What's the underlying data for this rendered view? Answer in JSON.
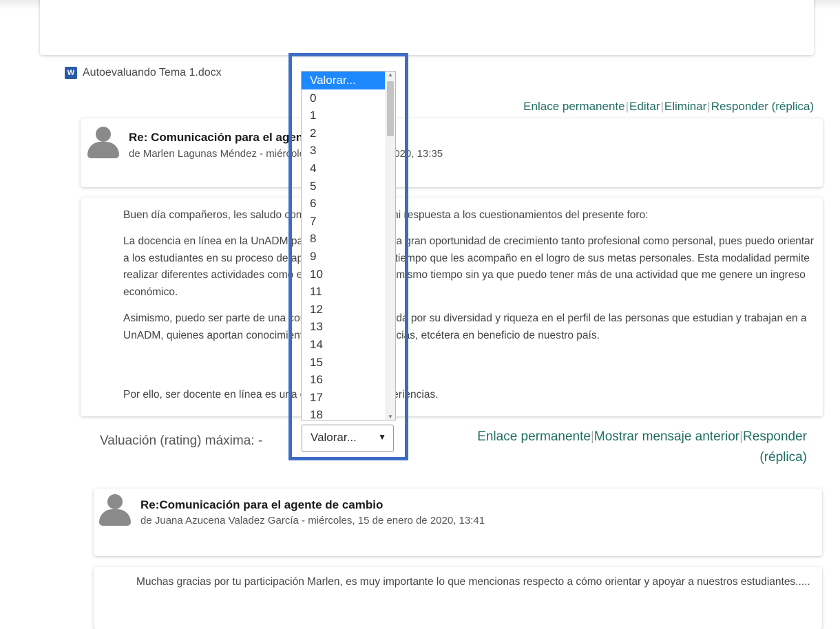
{
  "attachment": {
    "name": "Autoevaluando Tema 1.docx",
    "icon": "word-doc-icon"
  },
  "post1_links": [
    "Enlace permanente",
    "Editar",
    "Eliminar",
    "Responder (réplica)"
  ],
  "post2": {
    "title": "Re: Comunicación para el agente de cambio",
    "author": "de Marlen Lagunas Méndez - miércoles, 15 de enero de 2020, 13:35",
    "paragraphs": [
      "Buen día compañeros, les saludo con gusto y comparto mi respuesta a los cuestionamientos del presente foro:",
      "La docencia en línea en la UnADM para mí representa una gran oportunidad de crecimiento tanto profesional como personal, pues puedo orientar a los estudiantes en su proceso de aprendizaje al mismo tiempo que les acompaño en el logro de sus metas personales. Esta modalidad permite realizar diferentes actividades como estudiar y trabajar al mismo tiempo sin ya que puedo tener más de una actividad que me genere un ingreso económico.",
      "Asimismo, puedo ser parte de una comunidad caracterizada por su diversidad y riqueza en el perfil de las personas que estudian y trabajan en a UnADM, quienes aportan conocimientos, logros, experiencias, etcétera en beneficio de nuestro país.",
      "Por ello, ser docente en línea es una de mis mejores experiencias."
    ],
    "rating_label": "Valuación (rating) máxima: -",
    "links": [
      "Enlace permanente",
      "Mostrar mensaje anterior",
      "Responder",
      "(réplica)"
    ]
  },
  "rating_select": {
    "selected": "Valorar...",
    "options": [
      "Valorar...",
      "0",
      "1",
      "2",
      "3",
      "4",
      "5",
      "6",
      "7",
      "8",
      "9",
      "10",
      "11",
      "12",
      "13",
      "14",
      "15",
      "16",
      "17",
      "18"
    ]
  },
  "post3": {
    "title": "Re:Comunicación para el agente de cambio",
    "author": "de Juana Azucena Valadez García - miércoles, 15 de enero de 2020, 13:41",
    "paragraph": "Muchas gracias por tu participación Marlen, es muy importante lo que mencionas respecto a cómo orientar y apoyar a nuestros estudiantes....."
  },
  "colors": {
    "link": "#1f6e62",
    "highlight": "#3d6cc4",
    "selected_option": "#1e88ff"
  }
}
